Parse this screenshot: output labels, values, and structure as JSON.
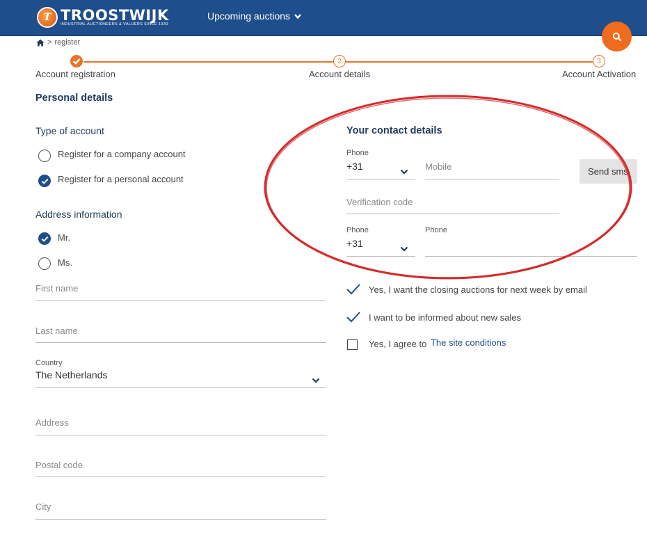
{
  "header": {
    "brand_name": "TROOSTWIJK",
    "brand_tagline": "INDUSTRIAL AUCTIONEERS & VALUERS SINCE 1930",
    "nav_auctions": "Upcoming auctions",
    "colors": {
      "header_bg": "#1f4e8c",
      "accent": "#e8742a",
      "search_bg": "#ef6b1d"
    }
  },
  "breadcrumb": {
    "separator": ">",
    "current": "register"
  },
  "steps": [
    {
      "number": "",
      "label": "Account registration",
      "state": "done"
    },
    {
      "number": "2",
      "label": "Account details",
      "state": "todo"
    },
    {
      "number": "3",
      "label": "Account Activation",
      "state": "todo"
    }
  ],
  "personal": {
    "title": "Personal details",
    "type_title": "Type of account",
    "company_option": "Register for a company account",
    "personal_option": "Register for a personal account",
    "selected_type": "personal",
    "address_title": "Address information",
    "mr_label": "Mr.",
    "ms_label": "Ms.",
    "selected_salutation": "Mr.",
    "first_name_placeholder": "First name",
    "last_name_placeholder": "Last name",
    "country_label": "Country",
    "country_value": "The Netherlands",
    "address_placeholder": "Address",
    "postal_placeholder": "Postal code",
    "city_placeholder": "City"
  },
  "contact": {
    "title": "Your contact details",
    "phone_label": "Phone",
    "phone_code_1": "+31",
    "mobile_placeholder": "Mobile",
    "send_sms_label": "Send sms",
    "verification_placeholder": "Verification code",
    "phone_label_2": "Phone",
    "phone_code_2": "+31",
    "phone_field_label": "Phone"
  },
  "options": {
    "closing_auctions": "Yes, I want the closing auctions for next week by email",
    "closing_auctions_checked": true,
    "new_sales": "I want to be informed about new sales",
    "new_sales_checked": true,
    "agree_prefix": "Yes, I agree to",
    "agree_link": "The site conditions",
    "agree_checked": false
  },
  "annotation_color": "#d42b2b"
}
